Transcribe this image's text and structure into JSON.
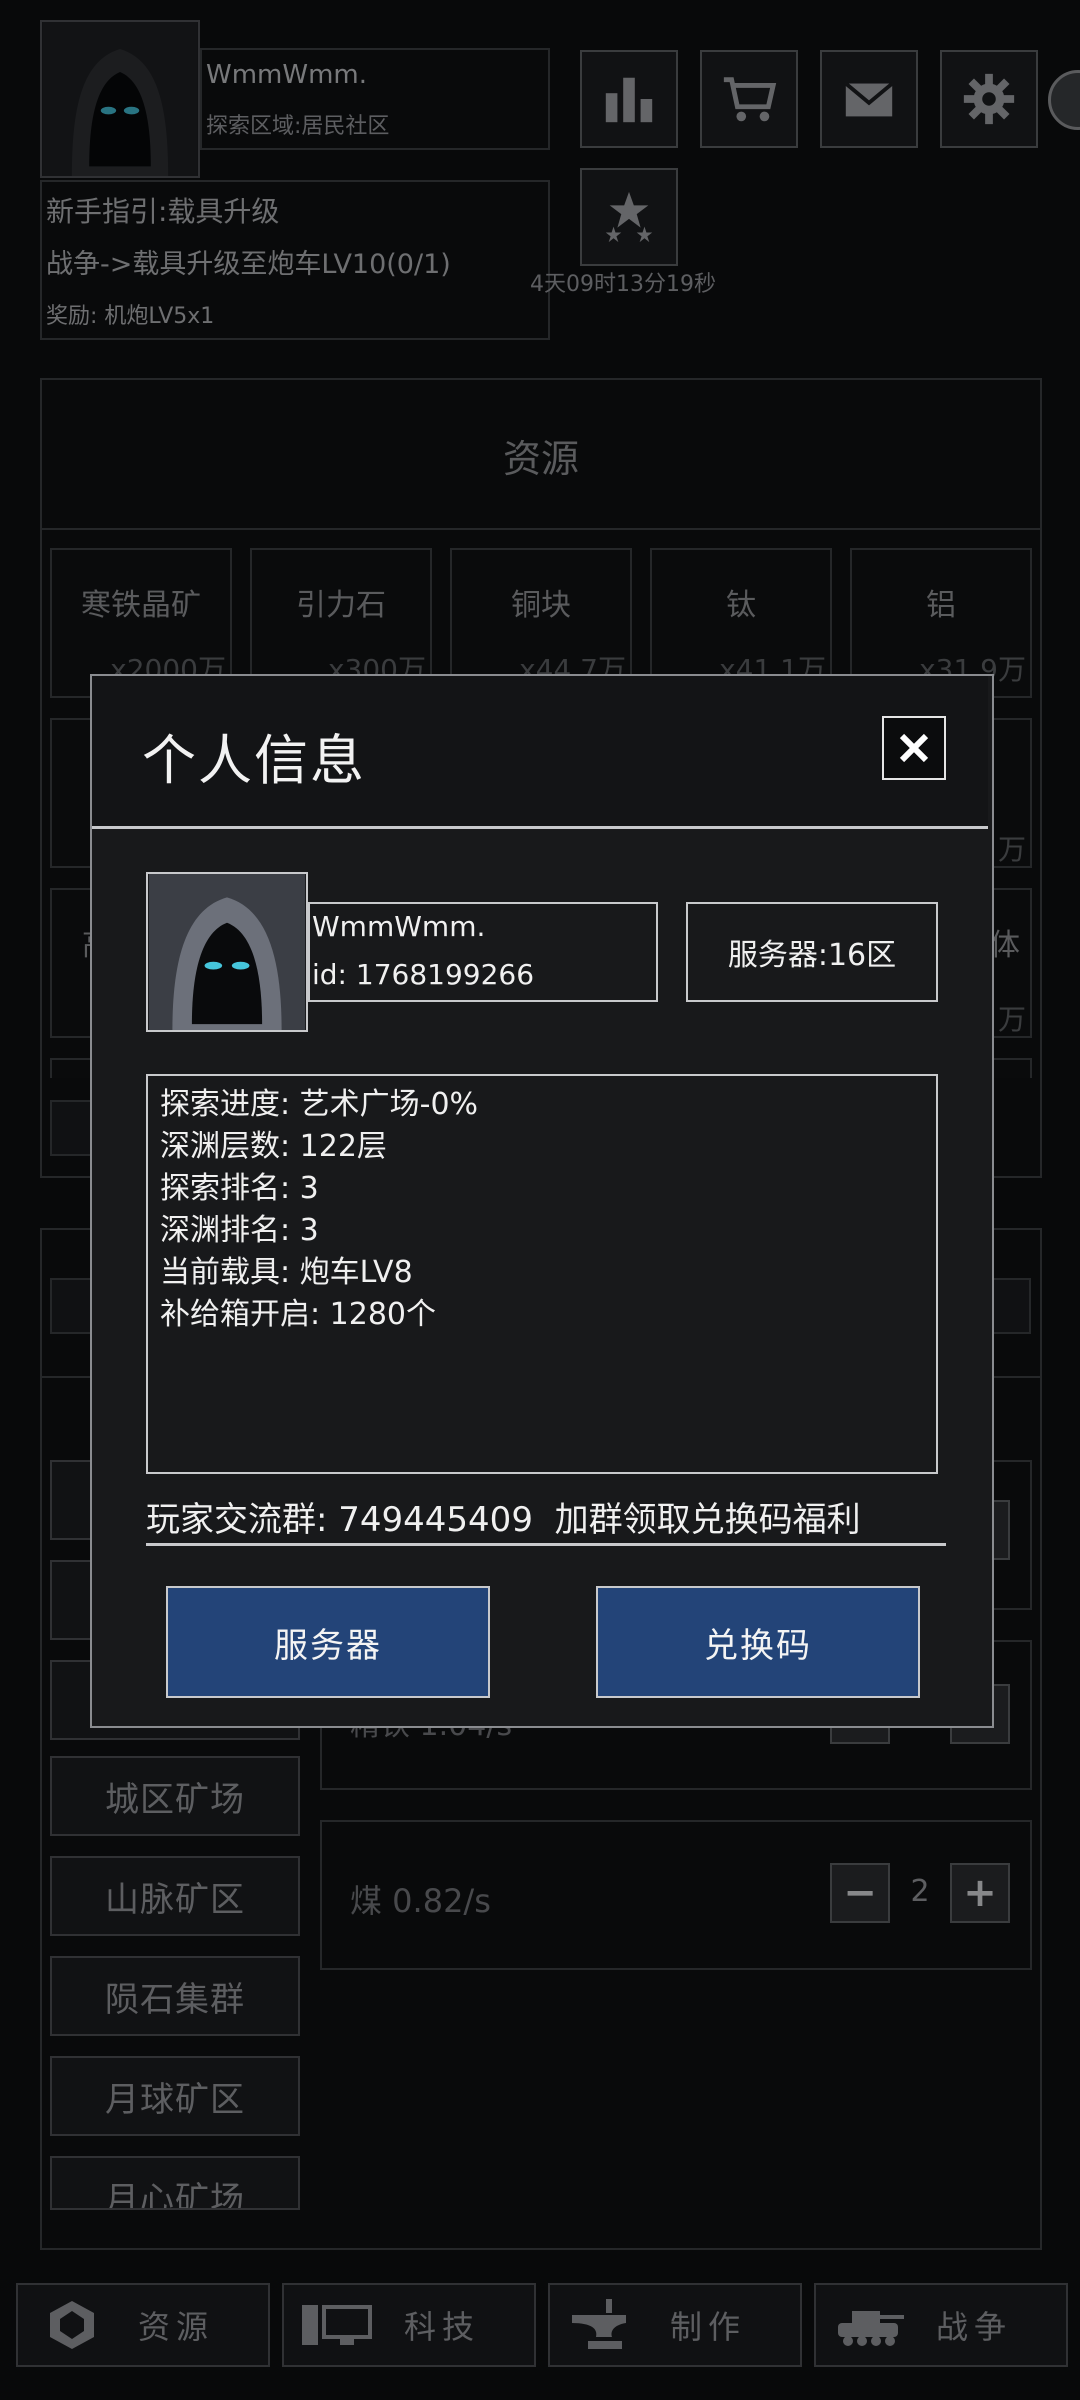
{
  "header": {
    "player_name": "WmmWmm.",
    "explore_area": "探索区域:居民社区",
    "guide_title": "新手指引:载具升级",
    "guide_task": "战争->载具升级至炮车LV10(0/1)",
    "guide_reward": "奖励: 机炮LV5x1",
    "countdown": "4天09时13分19秒"
  },
  "resources": {
    "title": "资源",
    "tiles": [
      {
        "name": "寒铁晶矿",
        "amount": "x2000万"
      },
      {
        "name": "引力石",
        "amount": "x300万"
      },
      {
        "name": "铜块",
        "amount": "x44.7万"
      },
      {
        "name": "钛",
        "amount": "x41.1万"
      },
      {
        "name": "铝",
        "amount": "x31.9万"
      }
    ],
    "row2_partial": {
      "right_amount": "万"
    },
    "row3_partial": {
      "left_char": "高",
      "right_char": "体",
      "right_amount": "万"
    }
  },
  "mining": {
    "areas": [
      "城区矿场",
      "山脉矿区",
      "陨石集群",
      "月球矿区",
      "月心矿场"
    ],
    "coal_rate": "煤 0.82/s",
    "coal_count": "2",
    "partial_rate": "精铁 1.04/s"
  },
  "modal": {
    "title": "个人信息",
    "name": "WmmWmm.",
    "id": "id: 1768199266",
    "server": "服务器:16区",
    "stats": [
      "探索进度: 艺术广场-0%",
      "深渊层数: 122层",
      "探索排名: 3",
      "深渊排名: 3",
      "当前载具: 炮车LV8",
      "补给箱开启: 1280个"
    ],
    "group_text": "玩家交流群: 749445409  加群领取兑换码福利",
    "server_button": "服务器",
    "redeem_button": "兑换码"
  },
  "nav": {
    "resources": "资源",
    "tech": "科技",
    "craft": "制作",
    "war": "战争"
  },
  "colors": {
    "background": "#0d0e10",
    "modal_button_blue": "#234478",
    "modal_border": "#c8c9cc"
  }
}
